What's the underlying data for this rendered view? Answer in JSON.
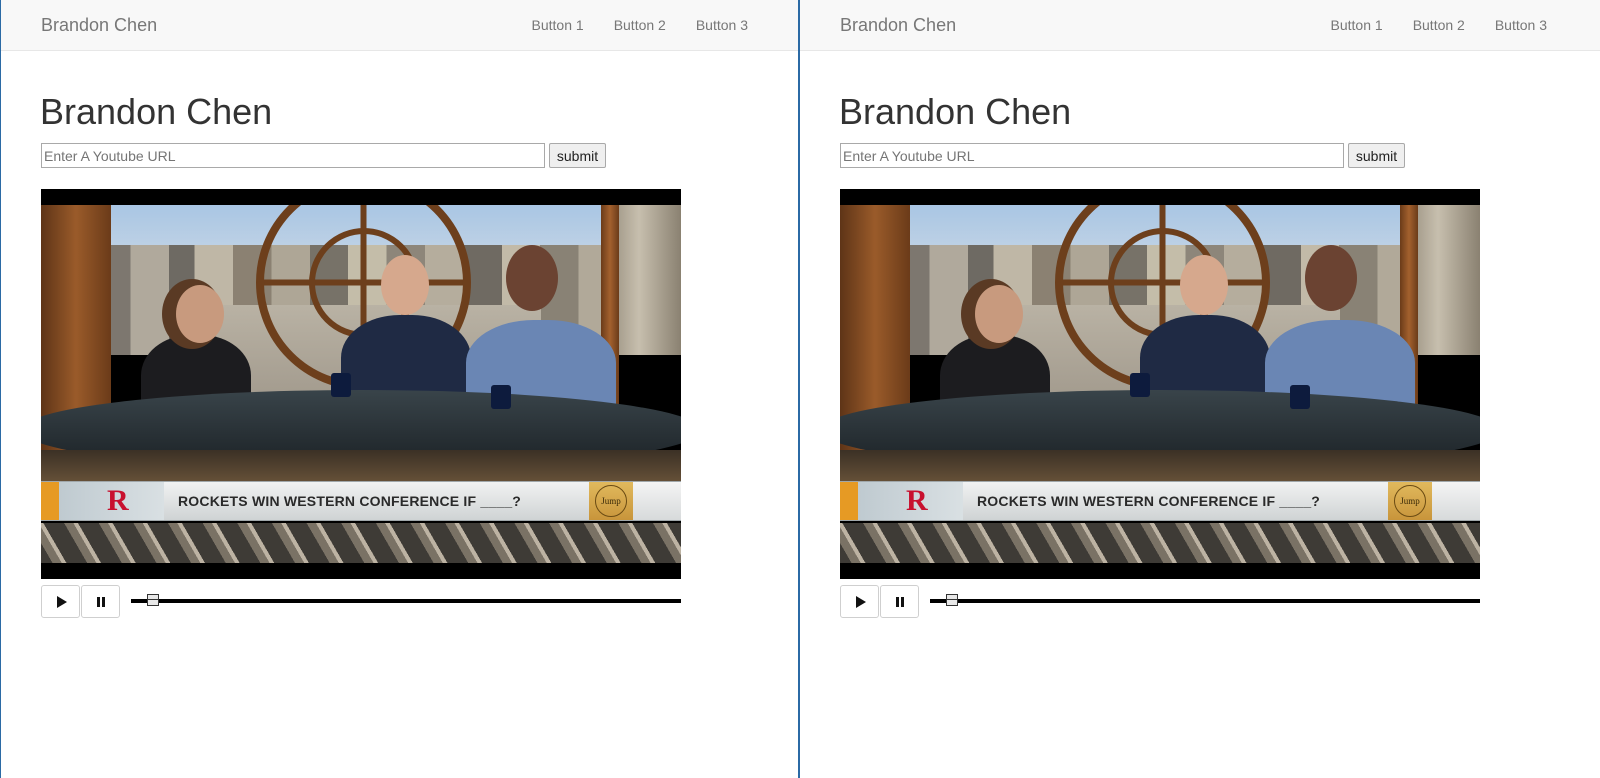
{
  "panes": [
    {
      "navbar": {
        "brand": "Brandon Chen",
        "links": [
          "Button 1",
          "Button 2",
          "Button 3"
        ]
      },
      "title": "Brandon Chen",
      "url_form": {
        "placeholder": "Enter A Youtube URL",
        "value": "",
        "submit_label": "submit"
      },
      "video": {
        "headline": "ROCKETS WIN WESTERN CONFERENCE IF ____?",
        "team_logo": "R",
        "show_logo": "Jump"
      },
      "seek_progress": 0.04
    },
    {
      "navbar": {
        "brand": "Brandon Chen",
        "links": [
          "Button 1",
          "Button 2",
          "Button 3"
        ]
      },
      "title": "Brandon Chen",
      "url_form": {
        "placeholder": "Enter A Youtube URL",
        "value": "",
        "submit_label": "submit"
      },
      "video": {
        "headline": "ROCKETS WIN WESTERN CONFERENCE IF ____?",
        "team_logo": "R",
        "show_logo": "Jump"
      },
      "seek_progress": 0.04
    }
  ],
  "icons": {
    "play": "play-icon",
    "pause": "pause-icon"
  },
  "colors": {
    "navbar_bg": "#f8f8f8",
    "nav_text": "#777777",
    "title_text": "#333333",
    "divider": "#2b6aa5",
    "rockets_red": "#c8102e"
  }
}
